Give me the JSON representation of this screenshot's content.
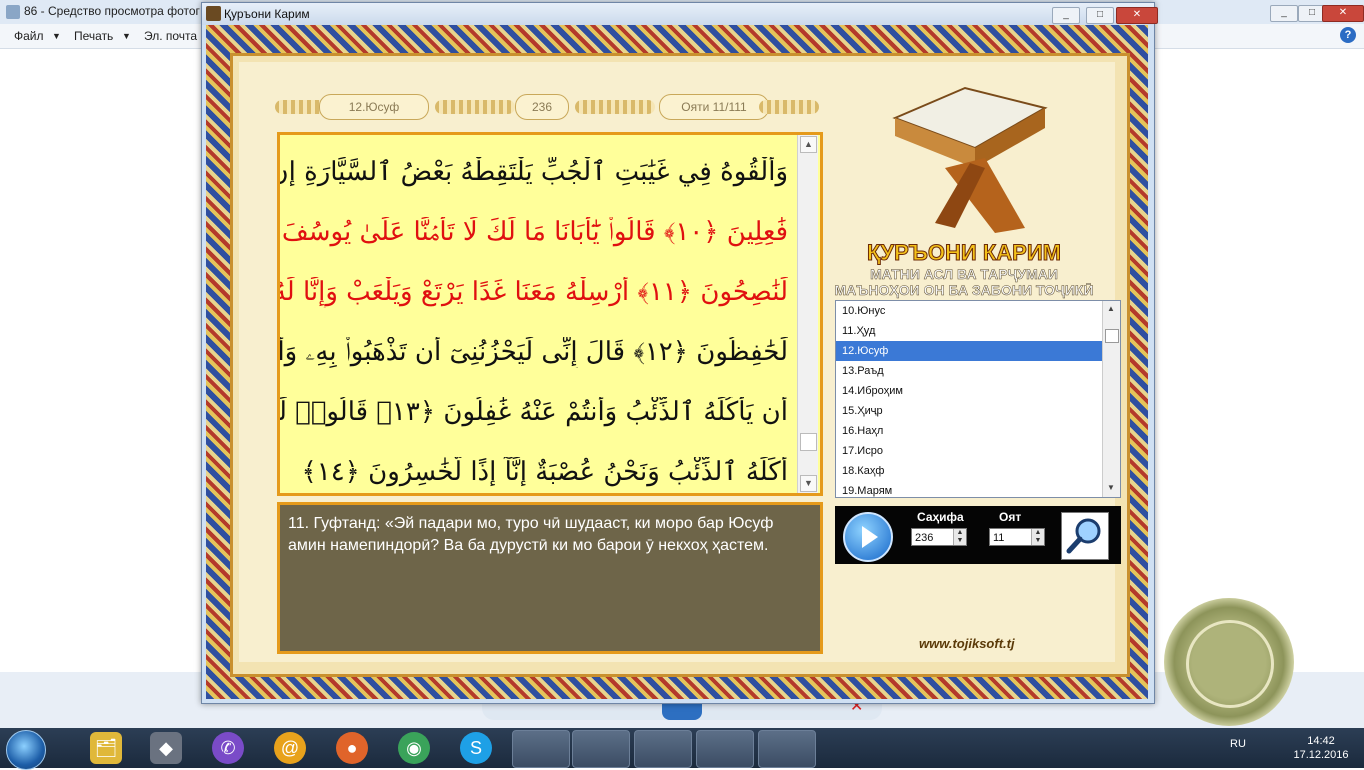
{
  "background_app": {
    "title": "86 - Средство просмотра фотог",
    "menu": [
      "Файл",
      "Печать",
      "Эл. почта"
    ],
    "help_icon": "help-icon",
    "window_controls": [
      "_",
      "□",
      "✕"
    ]
  },
  "quran_window": {
    "title": "Қуръони Карим",
    "window_controls": [
      "_",
      "□",
      "✕"
    ],
    "header": {
      "surah": "12.Юсуф",
      "page": "236",
      "ayah": "Ояти  11/111"
    },
    "arabic_lines": [
      {
        "text": "وَأَلْقُوهُ فِي غَيَٰبَتِ ٱلْجُبِّ يَلْتَقِطْهُ بَعْضُ ٱلسَّيَّارَةِ إِن كُنتُمْ",
        "highlight": false
      },
      {
        "text": "فَٰعِلِينَ ﴿١٠﴾ قَالُوا۟ يَٰٓأَبَانَا مَا لَكَ لَا تَأْمَ۬نَّا عَلَىٰ يُوسُفَ وَإِنَّا لَهُۥ",
        "highlight": true
      },
      {
        "text": "لَنَٰصِحُونَ ﴿١١﴾ أَرْسِلْهُ مَعَنَا غَدًا يَرْتَعْ وَيَلْعَبْ وَإِنَّا لَهُۥ",
        "highlight": true
      },
      {
        "text": "لَحَٰفِظُونَ ﴿١٢﴾ قَالَ إِنِّى لَيَحْزُنُنِىٓ أَن تَذْهَبُوا۟ بِهِۦ وَأَخَافُ",
        "highlight": false
      },
      {
        "text": "أَن يَأْكُلَهُ ٱلذِّئْبُ وَأَنتُمْ عَنْهُ غَٰفِلُونَ ﴿١٣﴾ قَالُوا۟ لَئِنْ",
        "highlight": false
      },
      {
        "text": "أَكَلَهُ ٱلذِّئْبُ وَنَحْنُ عُصْبَةٌ إِنَّآ إِذًا لَّخَٰسِرُونَ ﴿١٤﴾",
        "highlight": false
      }
    ],
    "translation": "11. Гуфтанд: «Эй падари мо, туро чӣ шудааст, ки моро бар Юсуф амин намепиндорӣ? Ва ба дурустӣ ки мо барои ӯ некхоҳ ҳастем.",
    "app_title": "ҚУРЪОНИ КАРИМ",
    "app_subtitle_1": "МАТНИ АСЛ ВА ТАРҶУМАИ",
    "app_subtitle_2": "МАЪНОҲОИ ОН БА ЗАБОНИ ТОҶИКӢ",
    "surah_list": [
      "10.Юнус",
      "11.Ҳуд",
      "12.Юсуф",
      "13.Раъд",
      "14.Иброҳим",
      "15.Ҳиҷр",
      "16.Наҳл",
      "17.Исро",
      "18.Каҳф",
      "19.Марям"
    ],
    "surah_selected": "12.Юсуф",
    "controls": {
      "page_label": "Саҳифа",
      "page_value": "236",
      "ayah_label": "Оят",
      "ayah_value": "11",
      "play_icon": "play-icon",
      "search_icon": "magnifier-icon"
    },
    "website": "www.tojiksoft.tj"
  },
  "taskbar": {
    "icons": [
      "explorer-icon",
      "game-controller-icon",
      "viber-icon",
      "mail-icon",
      "firefox-icon",
      "chrome-icon",
      "skype-icon"
    ],
    "language": "RU",
    "time": "14:42",
    "date": "17.12.2016"
  }
}
